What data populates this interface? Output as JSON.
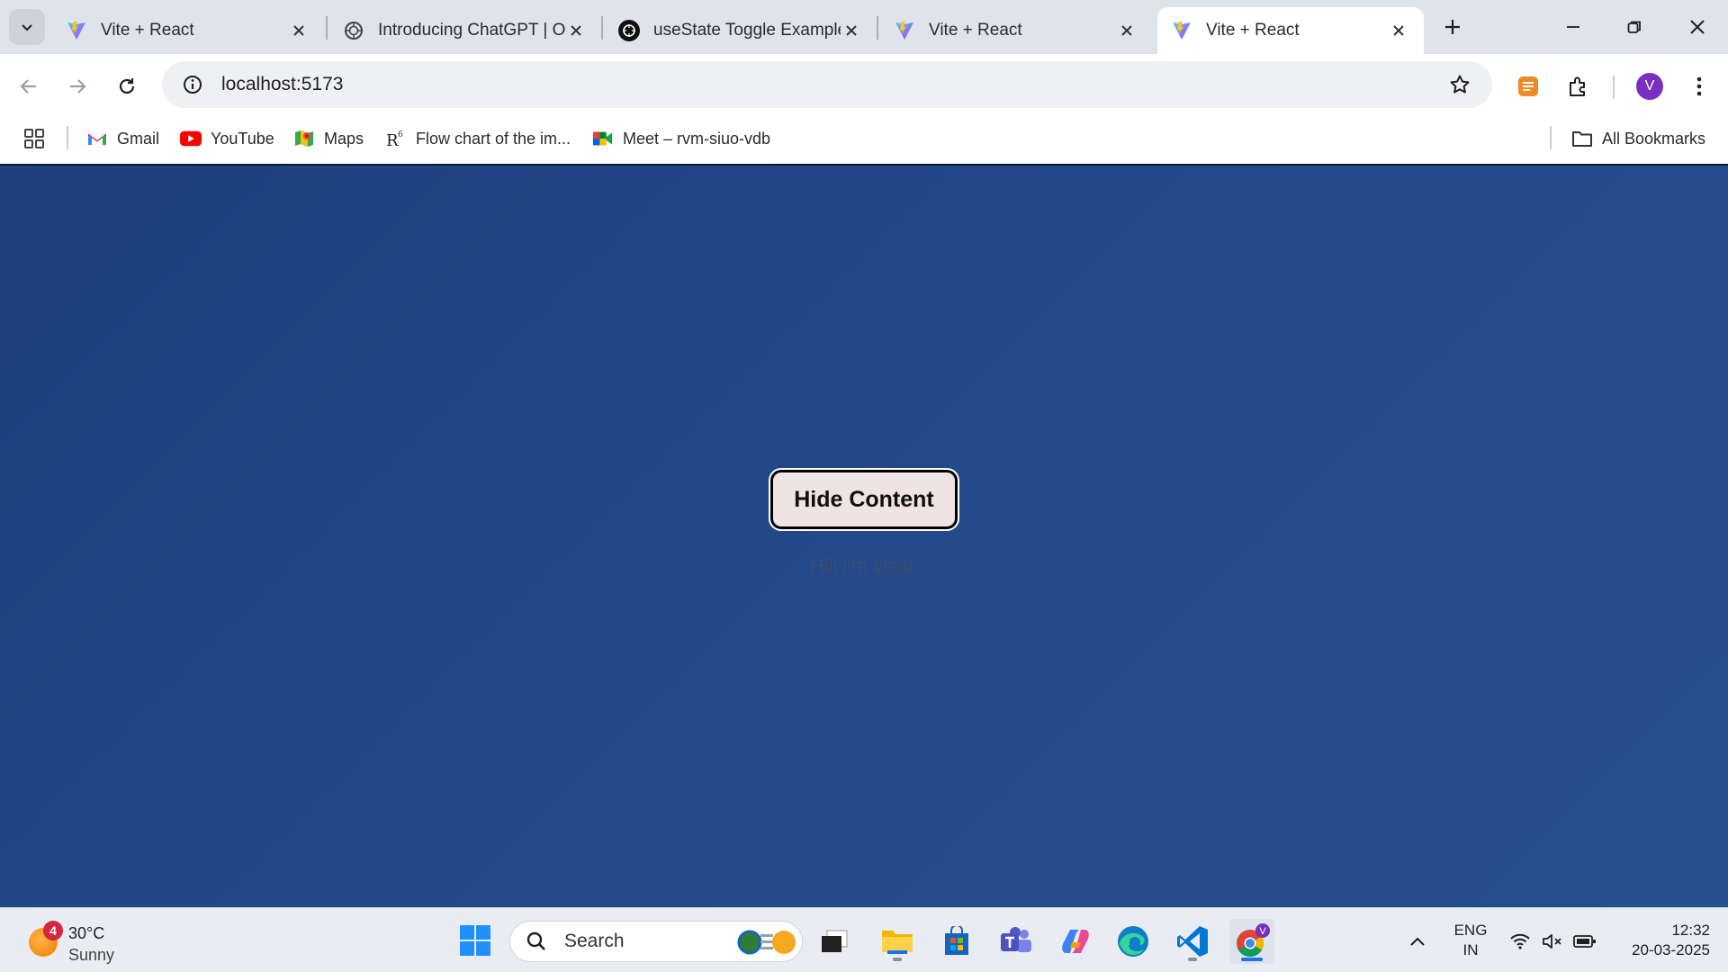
{
  "browser": {
    "tabs": [
      {
        "title": "Vite + React",
        "favicon": "vite-icon",
        "active": false
      },
      {
        "title": "Introducing ChatGPT | Op",
        "favicon": "openai-icon",
        "active": false
      },
      {
        "title": "useState Toggle Example",
        "favicon": "openai-icon",
        "active": false
      },
      {
        "title": "Vite + React",
        "favicon": "vite-icon",
        "active": false
      },
      {
        "title": "Vite + React",
        "favicon": "vite-icon",
        "active": true
      }
    ],
    "url": "localhost:5173",
    "profile_initial": "V",
    "bookmarks": [
      {
        "label": "Gmail",
        "icon": "gmail-icon"
      },
      {
        "label": "YouTube",
        "icon": "youtube-icon"
      },
      {
        "label": "Maps",
        "icon": "maps-icon"
      },
      {
        "label": "Flow chart of the im...",
        "icon": "r6-icon"
      },
      {
        "label": "Meet – rvm-siuo-vdb",
        "icon": "meet-icon"
      }
    ],
    "all_bookmarks_label": "All Bookmarks"
  },
  "page": {
    "toggle_button_label": "Hide Content",
    "content_text": "Hiii i'm visal.",
    "background_color": "#244a8b"
  },
  "taskbar": {
    "weather": {
      "badge": "4",
      "temperature": "30°C",
      "condition": "Sunny"
    },
    "search_placeholder": "Search",
    "language": {
      "line1": "ENG",
      "line2": "IN"
    },
    "clock": {
      "time": "12:32",
      "date": "20-03-2025"
    },
    "chrome_profile_initial": "V"
  }
}
